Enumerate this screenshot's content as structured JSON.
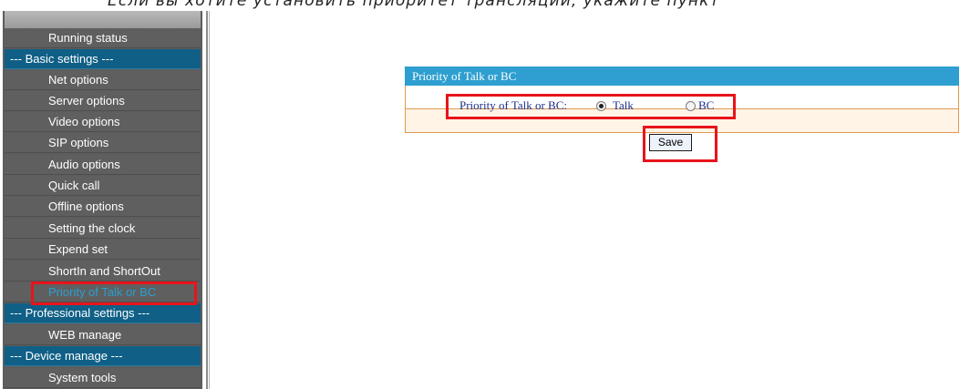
{
  "caption": "Если вы хотите установить приоритет трансляции, укажите пункт",
  "sidebar": {
    "items": [
      {
        "label": "Running status",
        "type": "item"
      },
      {
        "label": "--- Basic settings ---",
        "type": "section"
      },
      {
        "label": "Net options",
        "type": "item"
      },
      {
        "label": "Server options",
        "type": "item"
      },
      {
        "label": "Video options",
        "type": "item"
      },
      {
        "label": "SIP options",
        "type": "item"
      },
      {
        "label": "Audio options",
        "type": "item"
      },
      {
        "label": "Quick call",
        "type": "item"
      },
      {
        "label": "Offline options",
        "type": "item"
      },
      {
        "label": "Setting the clock",
        "type": "item"
      },
      {
        "label": "Expend set",
        "type": "item"
      },
      {
        "label": "ShortIn and ShortOut",
        "type": "item"
      },
      {
        "label": "Priority of Talk or BC",
        "type": "item",
        "active": true
      },
      {
        "label": "--- Professional settings ---",
        "type": "section"
      },
      {
        "label": "WEB manage",
        "type": "item"
      },
      {
        "label": "--- Device manage ---",
        "type": "section"
      },
      {
        "label": "System tools",
        "type": "item"
      }
    ]
  },
  "panel": {
    "title": "Priority of Talk or BC",
    "field_label": "Priority of Talk or BC:",
    "options": [
      {
        "label": "Talk",
        "selected": true
      },
      {
        "label": "BC",
        "selected": false
      }
    ],
    "save_label": "Save"
  },
  "colors": {
    "sidebar_bg": "#5f5f5f",
    "section_bg": "#0f5f86",
    "active_text": "#2a9fd0",
    "header_bg": "#2e9fd0",
    "panel_border": "#e09a52",
    "highlight": "#e8141b"
  }
}
